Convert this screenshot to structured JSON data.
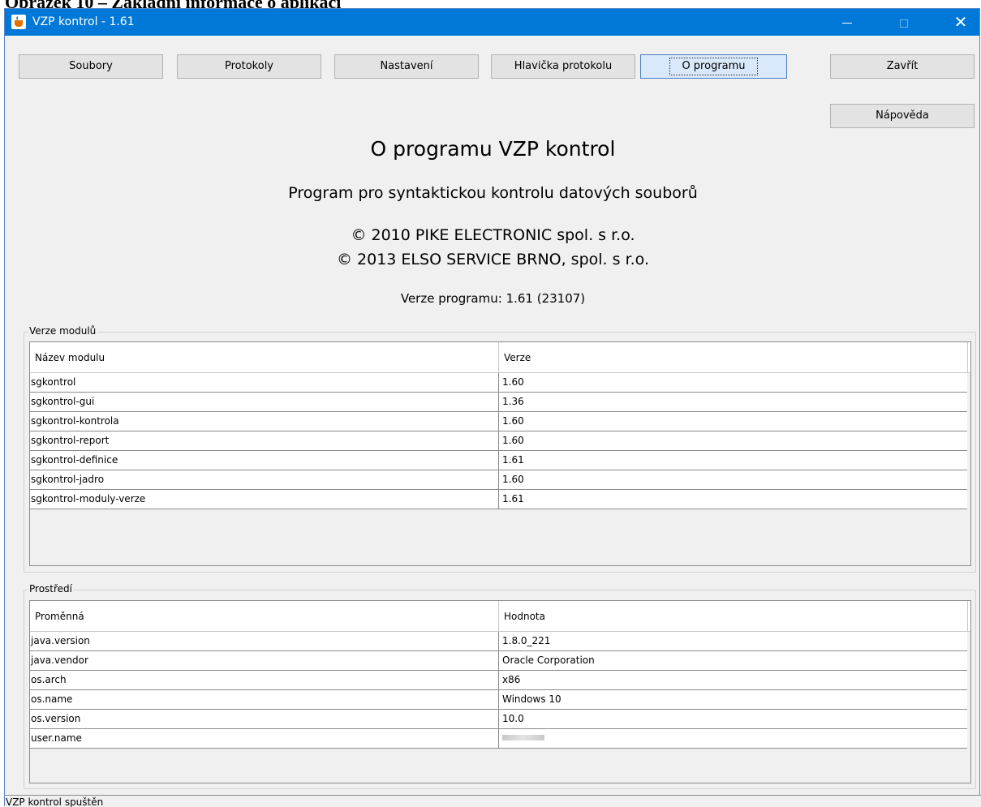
{
  "doc_caption": "Obrázek 10 – Základní informace o aplikaci",
  "window": {
    "title": "VZP kontrol - 1.61",
    "close_glyph": "✕"
  },
  "toolbar": {
    "soubory": "Soubory",
    "protokoly": "Protokoly",
    "nastaveni": "Nastavení",
    "hlavicka": "Hlavička protokolu",
    "o_programu": "O programu",
    "zavrit": "Zavřít",
    "napoveda": "Nápověda"
  },
  "about": {
    "title": "O programu VZP kontrol",
    "subtitle": "Program pro syntaktickou kontrolu datových souborů",
    "copyright1": "© 2010 PIKE ELECTRONIC spol. s r.o.",
    "copyright2": "© 2013 ELSO SERVICE BRNO, spol. s r.o.",
    "version": "Verze programu: 1.61 (23107)"
  },
  "modules": {
    "legend": "Verze modulů",
    "col_name": "Název modulu",
    "col_version": "Verze",
    "rows": [
      {
        "name": "sgkontrol",
        "version": "1.60"
      },
      {
        "name": "sgkontrol-gui",
        "version": "1.36"
      },
      {
        "name": "sgkontrol-kontrola",
        "version": "1.60"
      },
      {
        "name": "sgkontrol-report",
        "version": "1.60"
      },
      {
        "name": "sgkontrol-definice",
        "version": "1.61"
      },
      {
        "name": "sgkontrol-jadro",
        "version": "1.60"
      },
      {
        "name": "sgkontrol-moduly-verze",
        "version": "1.61"
      }
    ]
  },
  "environment": {
    "legend": "Prostředí",
    "col_name": "Proměnná",
    "col_value": "Hodnota",
    "rows": [
      {
        "name": "java.version",
        "value": "1.8.0_221"
      },
      {
        "name": "java.vendor",
        "value": "Oracle Corporation"
      },
      {
        "name": "os.arch",
        "value": "x86"
      },
      {
        "name": "os.name",
        "value": "Windows 10"
      },
      {
        "name": "os.version",
        "value": "10.0"
      },
      {
        "name": "user.name",
        "value": ""
      }
    ]
  },
  "status": {
    "text": "VZP kontrol spuštěn"
  }
}
